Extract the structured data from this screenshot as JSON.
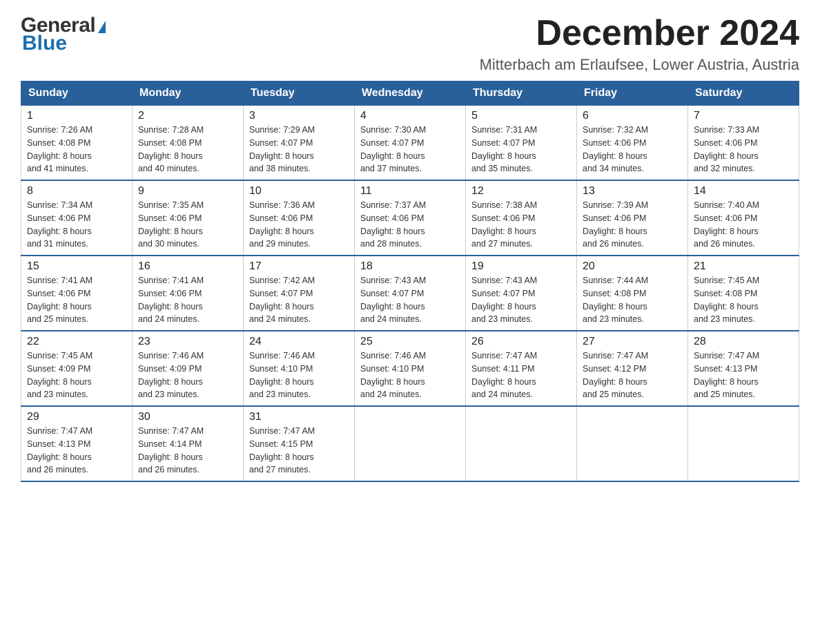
{
  "logo": {
    "general": "General",
    "blue": "Blue"
  },
  "header": {
    "month_year": "December 2024",
    "location": "Mitterbach am Erlaufsee, Lower Austria, Austria"
  },
  "weekdays": [
    "Sunday",
    "Monday",
    "Tuesday",
    "Wednesday",
    "Thursday",
    "Friday",
    "Saturday"
  ],
  "weeks": [
    [
      {
        "day": "1",
        "sunrise": "7:26 AM",
        "sunset": "4:08 PM",
        "daylight": "8 hours and 41 minutes."
      },
      {
        "day": "2",
        "sunrise": "7:28 AM",
        "sunset": "4:08 PM",
        "daylight": "8 hours and 40 minutes."
      },
      {
        "day": "3",
        "sunrise": "7:29 AM",
        "sunset": "4:07 PM",
        "daylight": "8 hours and 38 minutes."
      },
      {
        "day": "4",
        "sunrise": "7:30 AM",
        "sunset": "4:07 PM",
        "daylight": "8 hours and 37 minutes."
      },
      {
        "day": "5",
        "sunrise": "7:31 AM",
        "sunset": "4:07 PM",
        "daylight": "8 hours and 35 minutes."
      },
      {
        "day": "6",
        "sunrise": "7:32 AM",
        "sunset": "4:06 PM",
        "daylight": "8 hours and 34 minutes."
      },
      {
        "day": "7",
        "sunrise": "7:33 AM",
        "sunset": "4:06 PM",
        "daylight": "8 hours and 32 minutes."
      }
    ],
    [
      {
        "day": "8",
        "sunrise": "7:34 AM",
        "sunset": "4:06 PM",
        "daylight": "8 hours and 31 minutes."
      },
      {
        "day": "9",
        "sunrise": "7:35 AM",
        "sunset": "4:06 PM",
        "daylight": "8 hours and 30 minutes."
      },
      {
        "day": "10",
        "sunrise": "7:36 AM",
        "sunset": "4:06 PM",
        "daylight": "8 hours and 29 minutes."
      },
      {
        "day": "11",
        "sunrise": "7:37 AM",
        "sunset": "4:06 PM",
        "daylight": "8 hours and 28 minutes."
      },
      {
        "day": "12",
        "sunrise": "7:38 AM",
        "sunset": "4:06 PM",
        "daylight": "8 hours and 27 minutes."
      },
      {
        "day": "13",
        "sunrise": "7:39 AM",
        "sunset": "4:06 PM",
        "daylight": "8 hours and 26 minutes."
      },
      {
        "day": "14",
        "sunrise": "7:40 AM",
        "sunset": "4:06 PM",
        "daylight": "8 hours and 26 minutes."
      }
    ],
    [
      {
        "day": "15",
        "sunrise": "7:41 AM",
        "sunset": "4:06 PM",
        "daylight": "8 hours and 25 minutes."
      },
      {
        "day": "16",
        "sunrise": "7:41 AM",
        "sunset": "4:06 PM",
        "daylight": "8 hours and 24 minutes."
      },
      {
        "day": "17",
        "sunrise": "7:42 AM",
        "sunset": "4:07 PM",
        "daylight": "8 hours and 24 minutes."
      },
      {
        "day": "18",
        "sunrise": "7:43 AM",
        "sunset": "4:07 PM",
        "daylight": "8 hours and 24 minutes."
      },
      {
        "day": "19",
        "sunrise": "7:43 AM",
        "sunset": "4:07 PM",
        "daylight": "8 hours and 23 minutes."
      },
      {
        "day": "20",
        "sunrise": "7:44 AM",
        "sunset": "4:08 PM",
        "daylight": "8 hours and 23 minutes."
      },
      {
        "day": "21",
        "sunrise": "7:45 AM",
        "sunset": "4:08 PM",
        "daylight": "8 hours and 23 minutes."
      }
    ],
    [
      {
        "day": "22",
        "sunrise": "7:45 AM",
        "sunset": "4:09 PM",
        "daylight": "8 hours and 23 minutes."
      },
      {
        "day": "23",
        "sunrise": "7:46 AM",
        "sunset": "4:09 PM",
        "daylight": "8 hours and 23 minutes."
      },
      {
        "day": "24",
        "sunrise": "7:46 AM",
        "sunset": "4:10 PM",
        "daylight": "8 hours and 23 minutes."
      },
      {
        "day": "25",
        "sunrise": "7:46 AM",
        "sunset": "4:10 PM",
        "daylight": "8 hours and 24 minutes."
      },
      {
        "day": "26",
        "sunrise": "7:47 AM",
        "sunset": "4:11 PM",
        "daylight": "8 hours and 24 minutes."
      },
      {
        "day": "27",
        "sunrise": "7:47 AM",
        "sunset": "4:12 PM",
        "daylight": "8 hours and 25 minutes."
      },
      {
        "day": "28",
        "sunrise": "7:47 AM",
        "sunset": "4:13 PM",
        "daylight": "8 hours and 25 minutes."
      }
    ],
    [
      {
        "day": "29",
        "sunrise": "7:47 AM",
        "sunset": "4:13 PM",
        "daylight": "8 hours and 26 minutes."
      },
      {
        "day": "30",
        "sunrise": "7:47 AM",
        "sunset": "4:14 PM",
        "daylight": "8 hours and 26 minutes."
      },
      {
        "day": "31",
        "sunrise": "7:47 AM",
        "sunset": "4:15 PM",
        "daylight": "8 hours and 27 minutes."
      },
      null,
      null,
      null,
      null
    ]
  ],
  "labels": {
    "sunrise": "Sunrise:",
    "sunset": "Sunset:",
    "daylight": "Daylight:"
  }
}
